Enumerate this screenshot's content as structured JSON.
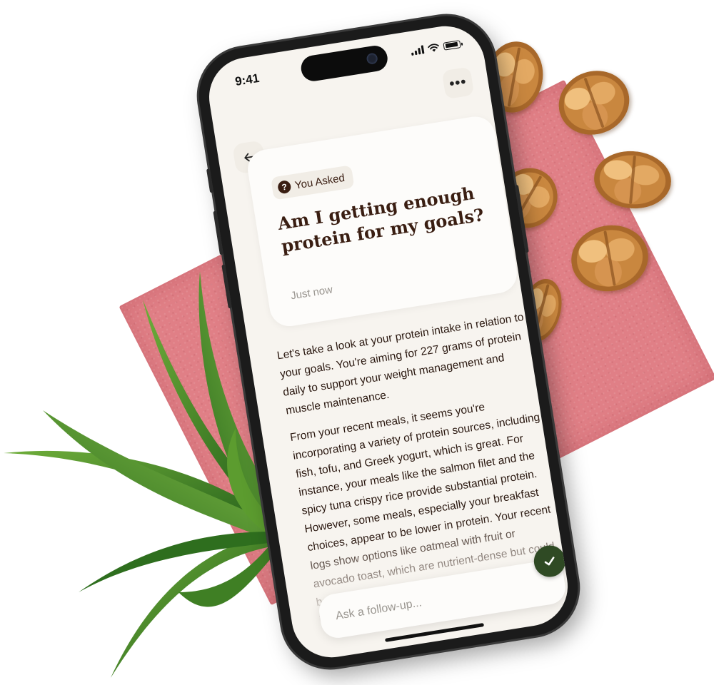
{
  "status_bar": {
    "time": "9:41"
  },
  "header": {
    "menu_icon": "more-horizontal-icon",
    "back_icon": "arrow-left-icon"
  },
  "question": {
    "badge_label": "You Asked",
    "badge_icon": "question-bubble-icon",
    "title": "Am I getting enough protein for my goals?",
    "timestamp": "Just now"
  },
  "answer": {
    "paragraphs": [
      "Let's take a look at your protein intake in relation to your goals. You're aiming for 227 grams of protein daily to support your weight management and muscle maintenance.",
      "From your recent meals, it seems you're incorporating a variety of protein sources, including fish, tofu, and Greek yogurt, which is great. For instance, your meals like the salmon filet and the spicy tuna crispy rice provide substantial protein. However, some meals, especially your breakfast choices, appear to be lower in protein. Your recent logs show options like oatmeal with fruit or avocado toast, which are nutrient-dense but could benefit from additional protein. Consider incorporating eggs, cottage"
    ]
  },
  "follow_up": {
    "placeholder": "Ask a follow-up...",
    "send_icon": "checkmark-icon"
  },
  "colors": {
    "screen_bg": "#f7f4ef",
    "card_bg": "#fdfcfa",
    "title_brown": "#3a1e12",
    "send_green": "#2f4a24",
    "paper_pink": "#e07f86"
  }
}
